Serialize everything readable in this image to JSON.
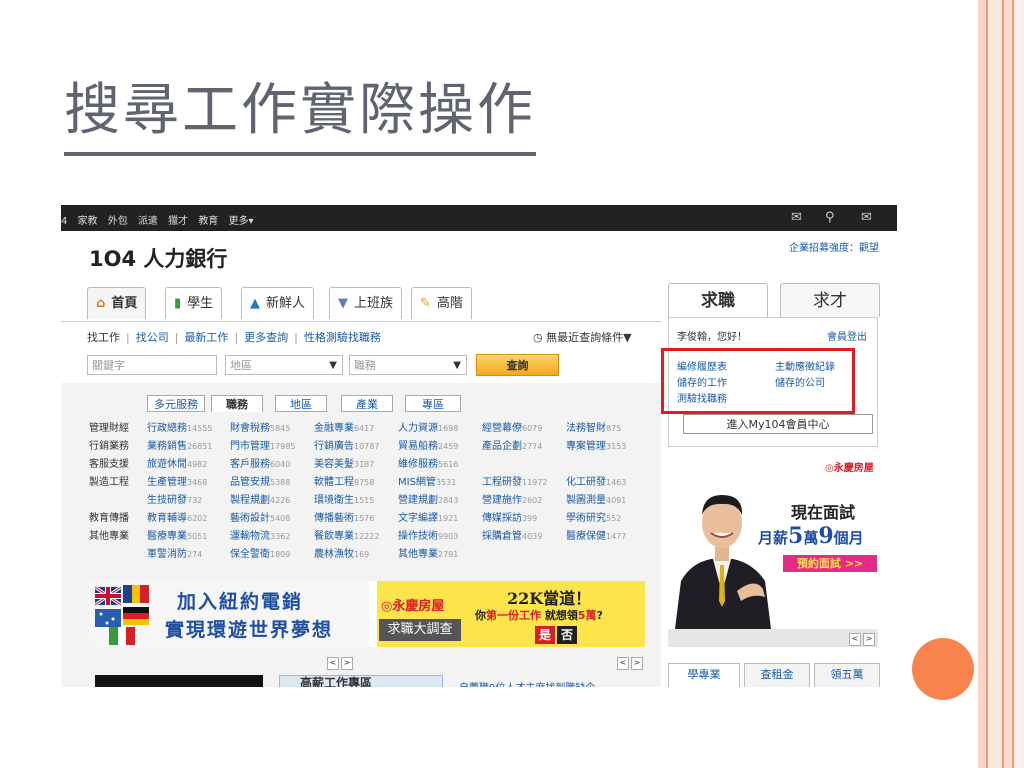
{
  "slide": {
    "title": "搜尋工作實際操作"
  },
  "topbar": {
    "links": [
      "4",
      "家教",
      "外包",
      "派遣",
      "獵才",
      "教育",
      "更多▾"
    ],
    "icons": [
      "chat-icon",
      "user-search-icon",
      "mail-icon"
    ]
  },
  "site": {
    "logo_num": "1O4",
    "logo_text": "人力銀行",
    "corp_link": "企業招募強度：觀望"
  },
  "main_tabs": [
    {
      "label": "首頁",
      "icon": "home-icon"
    },
    {
      "label": "學生",
      "icon": "book-icon"
    },
    {
      "label": "新鮮人",
      "icon": "graduation-cap-icon"
    },
    {
      "label": "上班族",
      "icon": "tie-icon"
    },
    {
      "label": "高階",
      "icon": "pen-icon"
    }
  ],
  "subnav": [
    "找工作",
    "找公司",
    "最新工作",
    "更多查詢",
    "性格測驗找職務"
  ],
  "history": "◷ 無最近查詢條件▼",
  "search": {
    "keyword_placeholder": "關鍵字",
    "area_placeholder": "地區",
    "job_placeholder": "職務",
    "button": "查詢"
  },
  "category_tabs": [
    "多元服務",
    "職務",
    "地區",
    "產業",
    "專區"
  ],
  "job_rows": [
    {
      "label": "管理財經",
      "items": [
        [
          "行政總務",
          "14555"
        ],
        [
          "財會稅務",
          "5845"
        ],
        [
          "金融專業",
          "6417"
        ],
        [
          "人力資源",
          "1698"
        ],
        [
          "經營幕僚",
          "6079"
        ],
        [
          "法務智財",
          "875"
        ]
      ]
    },
    {
      "label": "行銷業務",
      "items": [
        [
          "業務銷售",
          "26851"
        ],
        [
          "門市管理",
          "17985"
        ],
        [
          "行銷廣告",
          "10787"
        ],
        [
          "貿易船務",
          "2459"
        ],
        [
          "產品企劃",
          "2774"
        ],
        [
          "專案管理",
          "3153"
        ]
      ]
    },
    {
      "label": "客服支援",
      "items": [
        [
          "旅遊休閒",
          "4982"
        ],
        [
          "客戶服務",
          "6040"
        ],
        [
          "美容美髮",
          "3187"
        ],
        [
          "維修服務",
          "5616"
        ]
      ]
    },
    {
      "label": "製造工程",
      "items": [
        [
          "生產管理",
          "3468"
        ],
        [
          "品管安規",
          "5388"
        ],
        [
          "軟體工程",
          "8758"
        ],
        [
          "MIS網管",
          "3531"
        ],
        [
          "工程研發",
          "11972"
        ],
        [
          "化工研發",
          "1463"
        ]
      ]
    },
    {
      "label": "",
      "items": [
        [
          "生技研發",
          "732"
        ],
        [
          "製程規劃",
          "4226"
        ],
        [
          "環境衛生",
          "1515"
        ],
        [
          "營建規劃",
          "2843"
        ],
        [
          "營建施作",
          "2602"
        ],
        [
          "製圖測量",
          "4091"
        ]
      ]
    },
    {
      "label": "教育傳播",
      "items": [
        [
          "教育輔導",
          "6202"
        ],
        [
          "藝術設計",
          "5408"
        ],
        [
          "傳播藝術",
          "1576"
        ],
        [
          "文字編譯",
          "1921"
        ],
        [
          "傳媒採訪",
          "399"
        ],
        [
          "學術研究",
          "552"
        ]
      ]
    },
    {
      "label": "其他專業",
      "items": [
        [
          "醫療專業",
          "5051"
        ],
        [
          "運輸物流",
          "3362"
        ],
        [
          "餐飲專業",
          "12222"
        ],
        [
          "操作技術",
          "9903"
        ],
        [
          "採購倉管",
          "4039"
        ],
        [
          "醫療保健",
          "1477"
        ]
      ]
    },
    {
      "label": "",
      "items": [
        [
          "軍警消防",
          "274"
        ],
        [
          "保全警衛",
          "1809"
        ],
        [
          "農林漁牧",
          "169"
        ],
        [
          "其他專業",
          "2791"
        ]
      ]
    }
  ],
  "ads": {
    "ad1_line1": "加入紐約電銷",
    "ad1_line2": "實現環遊世界夢想",
    "ad2_logo": "◎永慶房屋",
    "ad2_box": "求職大調查",
    "ad2_headline": "22K當道！",
    "ad2_sub_a": "你",
    "ad2_sub_red": "第一份工作",
    "ad2_sub_b": " 就想領",
    "ad2_sub_red2": "5萬",
    "ad2_sub_c": "?",
    "ad2_yes": "是",
    "ad2_no": "否"
  },
  "pager": {
    "prev": "<",
    "next": ">"
  },
  "bottom": {
    "box_label": "高薪工作專區",
    "text": "自薦職9位人才主席找到職缺企"
  },
  "right_panel": {
    "tab_active": "求職",
    "tab_other": "求才",
    "greeting": "李俊翰，您好！",
    "logout": "會員登出",
    "links": [
      "編修履歷表",
      "主動應徵紀錄",
      "儲存的工作",
      "儲存的公司",
      "測驗找職務"
    ],
    "my104": "進入My104會員中心",
    "brand": "◎永慶房屋",
    "interview": "現在面試",
    "salary_a": "月薪",
    "salary_num1": "5",
    "salary_b": "萬",
    "salary_num2": "9",
    "salary_c": "個月",
    "book_btn": "預約面試 >>",
    "sub_tabs": [
      "學專業",
      "查租金",
      "領五萬"
    ]
  },
  "colors": {
    "accent_orange": "#f7844c",
    "highlight_red": "#e01e1e",
    "link_blue": "#1a5aa8"
  }
}
